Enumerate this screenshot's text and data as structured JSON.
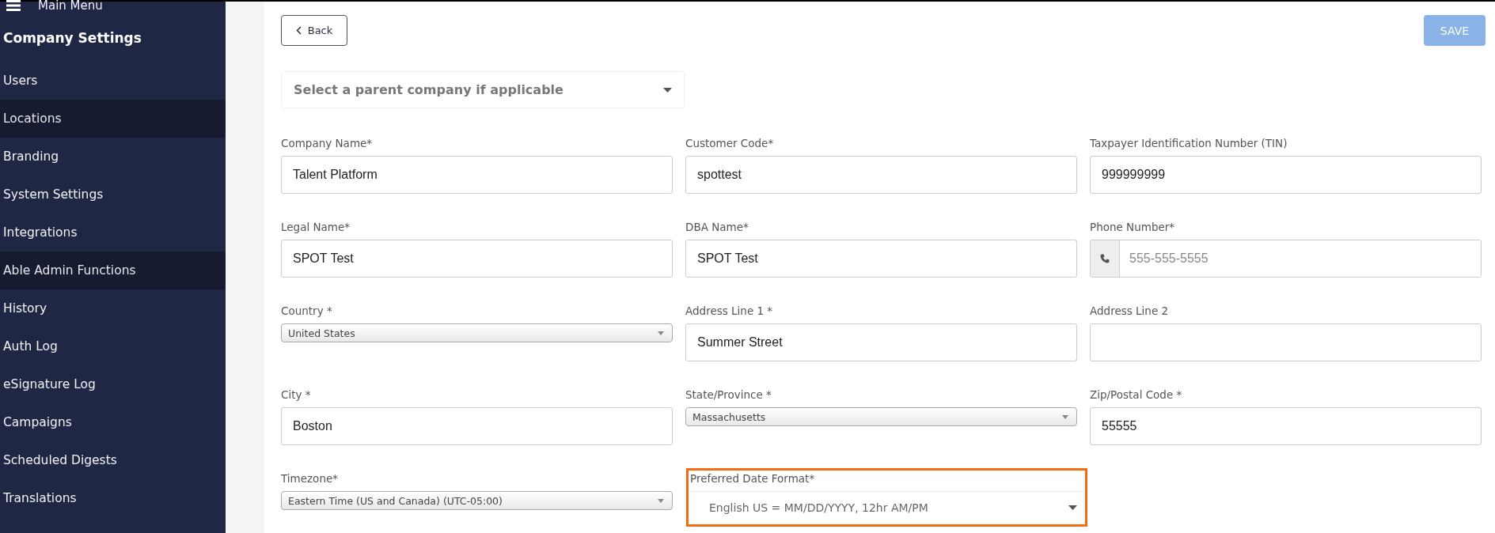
{
  "sidebar": {
    "menu_label": "Main Menu",
    "title": "Company Settings",
    "items": [
      {
        "label": "Users",
        "highlighted": false
      },
      {
        "label": "Locations",
        "highlighted": true
      },
      {
        "label": "Branding",
        "highlighted": false
      },
      {
        "label": "System Settings",
        "highlighted": false
      },
      {
        "label": "Integrations",
        "highlighted": false
      },
      {
        "label": "Able Admin Functions",
        "highlighted": true
      },
      {
        "label": "History",
        "highlighted": false
      },
      {
        "label": "Auth Log",
        "highlighted": false
      },
      {
        "label": "eSignature Log",
        "highlighted": false
      },
      {
        "label": "Campaigns",
        "highlighted": false
      },
      {
        "label": "Scheduled Digests",
        "highlighted": false
      },
      {
        "label": "Translations",
        "highlighted": false
      }
    ]
  },
  "toolbar": {
    "back_label": "Back",
    "save": {
      "label": "SAVE",
      "disabled": true
    }
  },
  "parent_company": {
    "placeholder": "Select a parent company if applicable"
  },
  "fields": [
    {
      "label": "Company Name*",
      "kind": "text",
      "value": "Talent Platform",
      "highlighted": false
    },
    {
      "label": "Customer Code*",
      "kind": "text",
      "value": "spottest",
      "highlighted": false
    },
    {
      "label": "Taxpayer Identification Number (TIN)",
      "kind": "text",
      "value": "999999999",
      "highlighted": false
    },
    {
      "label": "Legal Name*",
      "kind": "text",
      "value": "SPOT Test",
      "highlighted": false
    },
    {
      "label": "DBA Name*",
      "kind": "text",
      "value": "SPOT Test",
      "highlighted": false
    },
    {
      "label": "Phone Number*",
      "kind": "phone",
      "placeholder": "555-555-5555",
      "highlighted": false
    },
    {
      "label": "Country *",
      "kind": "select",
      "value": "United States",
      "highlighted": false
    },
    {
      "label": "Address Line 1 *",
      "kind": "text",
      "value": "Summer Street",
      "highlighted": false
    },
    {
      "label": "Address Line 2",
      "kind": "text",
      "highlighted": false
    },
    {
      "label": "City *",
      "kind": "text",
      "value": "Boston",
      "highlighted": false
    },
    {
      "label": "State/Province *",
      "kind": "select",
      "value": "Massachusetts",
      "highlighted": false
    },
    {
      "label": "Zip/Postal Code *",
      "kind": "text",
      "value": "55555",
      "highlighted": false
    },
    {
      "label": "Timezone*",
      "kind": "select",
      "value": "Eastern Time (US and Canada) (UTC-05:00)",
      "highlighted": false
    },
    {
      "label": "Preferred Date Format*",
      "kind": "dropdown",
      "value": "English US = MM/DD/YYYY, 12hr AM/PM",
      "highlighted": true
    }
  ]
}
